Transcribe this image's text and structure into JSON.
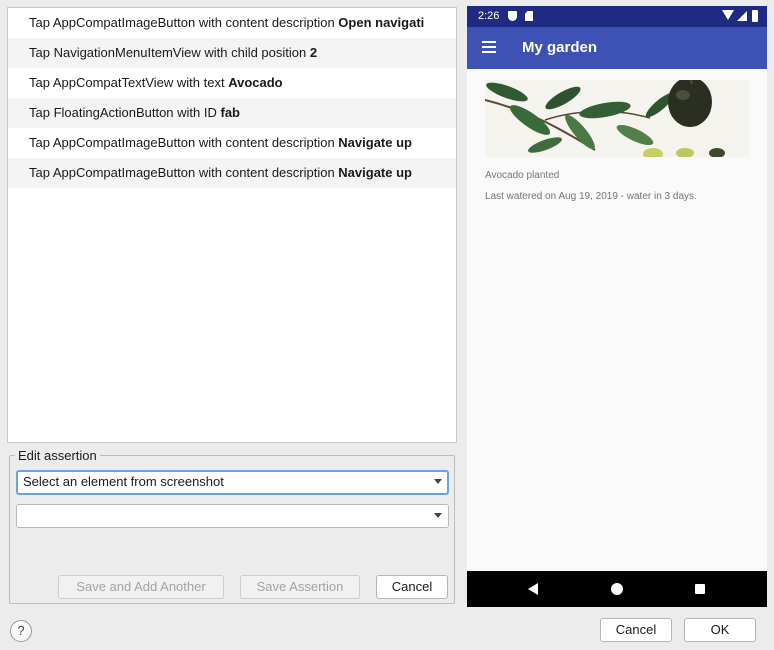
{
  "actions": [
    {
      "prefix": "Tap AppCompatImageButton with content description ",
      "bold": "Open navigati"
    },
    {
      "prefix": "Tap NavigationMenuItemView with child position ",
      "bold": "2"
    },
    {
      "prefix": "Tap AppCompatTextView with text ",
      "bold": "Avocado"
    },
    {
      "prefix": "Tap FloatingActionButton with ID ",
      "bold": "fab"
    },
    {
      "prefix": "Tap AppCompatImageButton with content description ",
      "bold": "Navigate up"
    },
    {
      "prefix": "Tap AppCompatImageButton with content description ",
      "bold": "Navigate up"
    }
  ],
  "edit_assertion": {
    "legend": "Edit assertion",
    "element_select": "Select an element from screenshot",
    "assertion_select": "",
    "save_and_add_label": "Save and Add Another",
    "save_assertion_label": "Save Assertion",
    "cancel_label": "Cancel"
  },
  "dialog": {
    "help_label": "?",
    "cancel_label": "Cancel",
    "ok_label": "OK"
  },
  "device": {
    "status_time": "2:26",
    "app_title": "My garden",
    "plant_name": "Avocado planted",
    "plant_water": "Last watered on Aug 19, 2019 - water in 3 days.",
    "colors": {
      "status_bar": "#1f2b83",
      "app_bar": "#3e51b5",
      "nav_bar": "#000000"
    }
  },
  "icons": {
    "menu": "hamburger-menu-icon",
    "back": "back-triangle-icon",
    "home": "home-circle-icon",
    "recents": "recents-square-icon"
  }
}
